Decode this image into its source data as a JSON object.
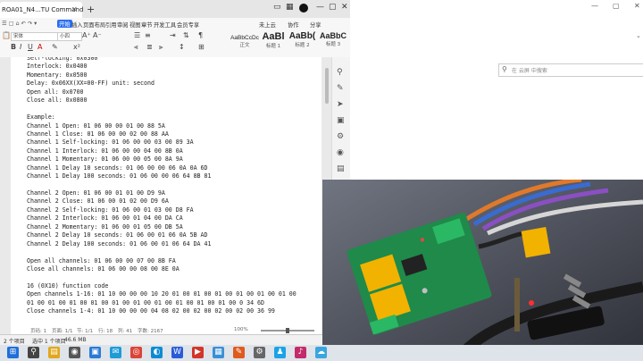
{
  "wps": {
    "doc_tab": "ROA01_N4...TU Command",
    "tab_add": "+",
    "menu": [
      "开始",
      "插入",
      "页面布局",
      "引用",
      "审阅",
      "视图",
      "章节",
      "开发工具",
      "会员专享"
    ],
    "menu_right": [
      "未上云",
      "协作",
      "分享"
    ],
    "ribbon": {
      "font_name": "宋体",
      "font_size": "小四",
      "styles": [
        {
          "sample": "AaBbCcDc",
          "name": "正文"
        },
        {
          "sample": "AaBl",
          "name": "标题 1"
        },
        {
          "sample": "AaBb(",
          "name": "标题 2"
        },
        {
          "sample": "AaBbC",
          "name": "标题 3"
        }
      ]
    },
    "lines": [
      "Self-locking: 0x0300",
      "Interlock: 0x0400",
      "Momentary: 0x0500",
      "Delay: 0x06XX(XX=00-FF) unit: second",
      "Open all: 0x0700",
      "Close all: 0x0800",
      "",
      "Example:",
      "Channel 1 Open: 01 06 00 00 01 00 88 5A",
      "Channel 1 Close: 01 06 00 00 02 00 88 AA",
      "Channel 1 Self-locking: 01 06 00 00 03 00 89 3A",
      "Channel 1 Interlock: 01 06 00 00 04 00 8B 0A",
      "Channel 1 Momentary: 01 06 00 00 05 00 8A 9A",
      "Channel 1 Delay 10 seconds: 01 06 00 00 06 0A 0A 6D",
      "Channel 1 Delay 100 seconds: 01 06 00 00 06 64 8B 81",
      "",
      "Channel 2 Open: 01 06 00 01 01 00 D9 9A",
      "Channel 2 Close: 01 06 00 01 02 00 D9 6A",
      "Channel 2 Self-locking: 01 06 00 01 03 00 D8 FA",
      "Channel 2 Interlock: 01 06 00 01 04 00 DA CA",
      "Channel 2 Momentary: 01 06 00 01 05 00 DB 5A",
      "Channel 2 Delay 10 seconds: 01 06 00 01 06 0A 5B AD",
      "Channel 2 Delay 100 seconds: 01 06 00 01 06 64 DA 41",
      "",
      "Open all channels: 01 06 00 00 07 00 8B FA",
      "Close all channels: 01 06 00 00 08 00 8E 0A",
      "",
      "16 (0X10) function code",
      "Open channels 1-16: 01 10 00 00 00 10 20 01 00 01 00 01 00 01 00 01 00 01 00",
      "01 00 01 00 01 00 01 00 01 00 01 00 01 00 01 00 01 00 01 00 0 34 6D",
      "Close channels 1-4: 01 10 00 00 00 04 08 02 00 02 00 02 00 02 00 36 99"
    ],
    "status": {
      "items": "2 个项目",
      "selected": "选中 1 个项目",
      "size": "46.6 MB",
      "page": "页码: 1",
      "pages": "页面: 1/1",
      "section": "节: 1/1",
      "row": "行: 18",
      "col": "列: 41",
      "words": "字数: 2167",
      "zoom": "100%"
    }
  },
  "explorer": {
    "search_placeholder": "在 云屏 中搜索"
  },
  "colors": {
    "accent": "#2b6ef0",
    "video_bg": "#3b3f4a",
    "pcb_green": "#1f8a4a",
    "relay_yellow": "#f2b200"
  },
  "taskbar_icons": [
    "windows-icon",
    "search-icon",
    "explorer-icon",
    "camera-icon",
    "store-icon",
    "mail-icon",
    "chrome-icon",
    "edge-icon",
    "word-icon",
    "video-icon",
    "photos-icon",
    "wps-icon",
    "settings-icon",
    "qq-icon",
    "music-icon",
    "cloud-icon"
  ]
}
